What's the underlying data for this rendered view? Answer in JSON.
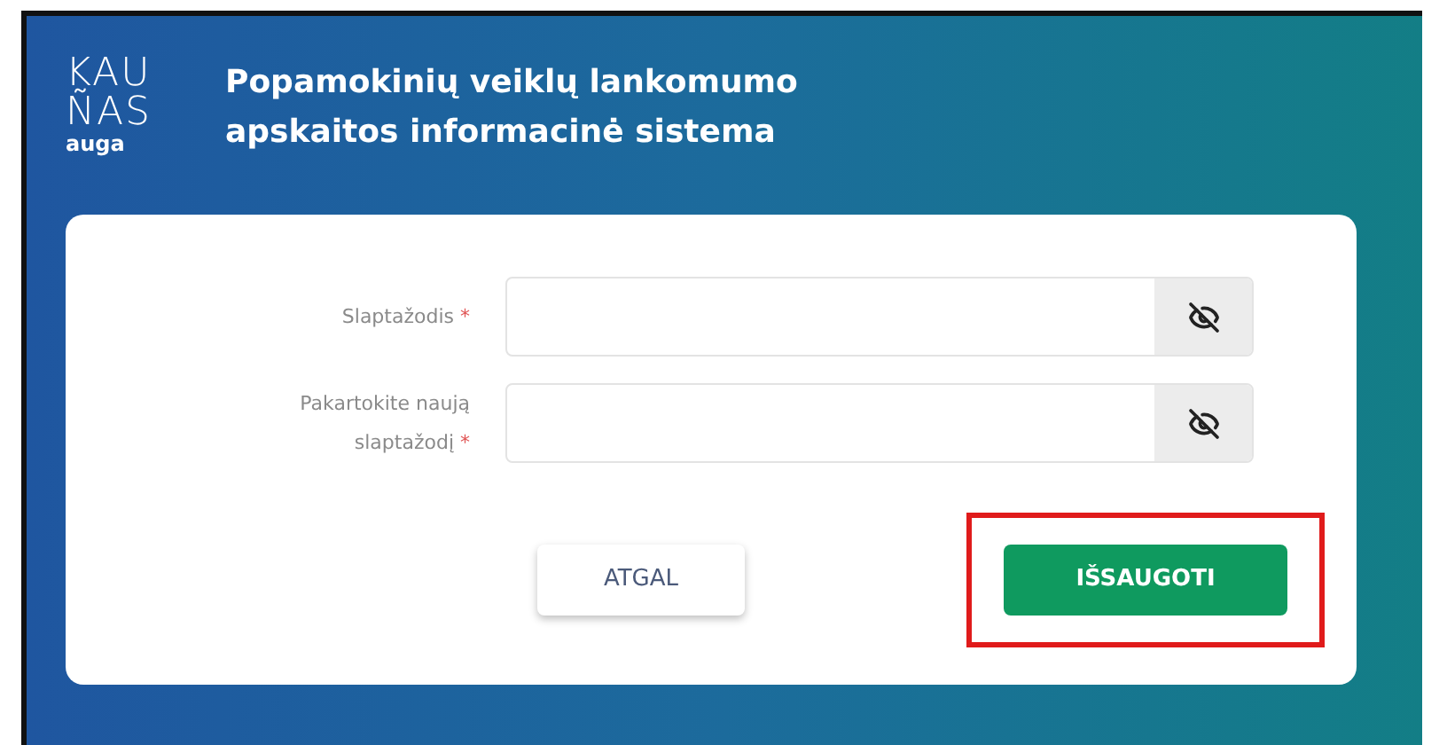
{
  "logo": {
    "line_1": "KAU",
    "line_2": "ÑAS",
    "tagline": "auga"
  },
  "title": "Popamokinių veiklų lankomumo apskaitos informacinė sistema",
  "fields": [
    {
      "label": "Slaptažodis",
      "required_mark": "*",
      "password_hidden": true
    },
    {
      "label": "Pakartokite naują slaptažodį",
      "required_mark": "*",
      "password_hidden": true
    }
  ],
  "buttons": [
    {
      "label": "ATGAL",
      "kind": "secondary",
      "highlighted": false
    },
    {
      "label": "IŠSAUGOTI",
      "kind": "primary",
      "highlighted": true
    }
  ]
}
